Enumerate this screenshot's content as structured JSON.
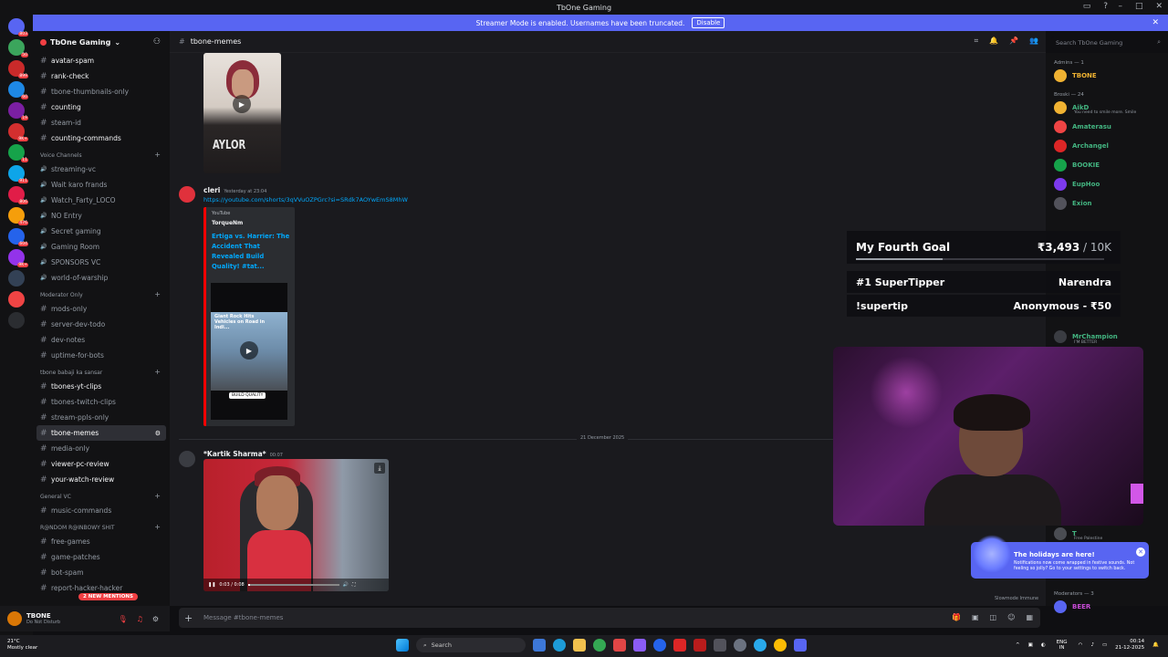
{
  "window": {
    "title": "TbOne Gaming"
  },
  "banner": {
    "text": "Streamer Mode is enabled. Usernames have been truncated.",
    "button": "Disable"
  },
  "guild_badges": [
    "803",
    "50",
    "899",
    "60",
    "19",
    "9K+",
    "11",
    "911",
    "806",
    "476",
    "604",
    "9K+"
  ],
  "server": {
    "name": "TbOne Gaming"
  },
  "channels_top": [
    {
      "name": "avatar-spam",
      "bold": true
    },
    {
      "name": "rank-check",
      "bold": true
    },
    {
      "name": "tbone-thumbnails-only",
      "bold": false
    },
    {
      "name": "counting",
      "bold": true
    },
    {
      "name": "steam-id",
      "bold": false
    },
    {
      "name": "counting-commands",
      "bold": true
    }
  ],
  "voice_category": "Voice Channels",
  "voice_channels": [
    "streaming-vc",
    "Wait karo frands",
    "Watch_Farty_LOCO",
    "NO Entry",
    "Secret gaming",
    "Gaming Room",
    "SPONSORS VC",
    "world-of-warship"
  ],
  "mod_category": "Moderator Only",
  "mod_channels": [
    "mods-only",
    "server-dev-todo",
    "dev-notes",
    "uptime-for-bots"
  ],
  "tbone_category": "tbone babaji ka sansar",
  "tbone_channels": [
    {
      "name": "tbones-yt-clips",
      "bold": true
    },
    {
      "name": "tbones-twitch-clips",
      "bold": false
    },
    {
      "name": "stream-ppls-only",
      "bold": false
    },
    {
      "name": "tbone-memes",
      "bold": true,
      "active": true
    },
    {
      "name": "media-only",
      "bold": false
    },
    {
      "name": "viewer-pc-review",
      "bold": true
    },
    {
      "name": "your-watch-review",
      "bold": true
    }
  ],
  "general_category": "General VC",
  "general_channels": [
    "music-commands"
  ],
  "random_category": "R@NDOM R@INBOWY SHIT",
  "random_channels": [
    "free-games",
    "game-patches",
    "bot-spam",
    "report-hacker-hacker"
  ],
  "mentions_pill": "2 NEW MENTIONS",
  "user": {
    "name": "TBONE",
    "status": "Do Not Disturb"
  },
  "chat": {
    "channel": "tbone-memes",
    "search_placeholder": "Search TbOne Gaming",
    "thumb_text": "AYLOR",
    "msg1": {
      "author": "cleri",
      "time": "Yesterday at 23:04",
      "link": "https://youtube.com/shorts/3qVVuOZPGrc?si=SRdk7AOYwEmS8MhW"
    },
    "embed": {
      "provider": "YouTube",
      "author": "TorqueNm",
      "title": "Ertiga vs. Harrier: The Accident That Revealed Build Quality! #tat...",
      "img_caption": "Giant Rock Hits Vehicles on Road in Indi...",
      "img_label": "BUILD QUALITY"
    },
    "date_divider": "21 December 2025",
    "msg2": {
      "author": "*Kartik Sharma*",
      "time": "00:07"
    },
    "video": {
      "time": "0:03 / 0:08"
    },
    "composer_placeholder": "Message #tbone-memes",
    "slowmode": "Slowmode Immune"
  },
  "members": {
    "admins_label": "Admins — 1",
    "admins": [
      {
        "name": "TBONE",
        "color": "#f0b232"
      }
    ],
    "broski_label": "Broski — 24",
    "broski": [
      {
        "name": "AikD",
        "sub": "You need to smile more. Smile",
        "color": "#43b581"
      },
      {
        "name": "Amaterasu",
        "sub": "",
        "color": "#43b581"
      },
      {
        "name": "Archangel",
        "sub": "",
        "color": "#43b581"
      },
      {
        "name": "BOOKIE",
        "sub": "",
        "color": "#43b581"
      },
      {
        "name": "EupHoo",
        "sub": "",
        "color": "#43b581"
      },
      {
        "name": "Exion",
        "sub": "",
        "color": "#43b581"
      }
    ],
    "hidden_member": {
      "name": "MrChampion",
      "sub": "I'M BETTER",
      "color": "#43b581"
    },
    "member_rawr": {
      "name": "T",
      "sub": "Free Palestine",
      "color": "#43b581"
    },
    "moderators_label": "Moderators — 3",
    "moderators": [
      {
        "name": "BEER",
        "color": "#c74bd6"
      }
    ]
  },
  "overlay": {
    "goal_title": "My Fourth Goal",
    "goal_amount": "₹3,493",
    "goal_target": " / 10K",
    "goal_progress": 0.35,
    "tipper_label": "#1 SuperTipper",
    "tipper_name": "Narendra",
    "supertip_label": "!supertip",
    "supertip_value": "Anonymous - ₹50"
  },
  "toast": {
    "title": "The holidays are here!",
    "body": "Notifications now come wrapped in festive sounds. Not feeling so jolly? Go to your settings to switch back."
  },
  "taskbar": {
    "weather_temp": "21°C",
    "weather_desc": "Mostly clear",
    "search": "Search",
    "lang": "ENG IN",
    "time": "00:14",
    "date": "21-12-2025"
  }
}
